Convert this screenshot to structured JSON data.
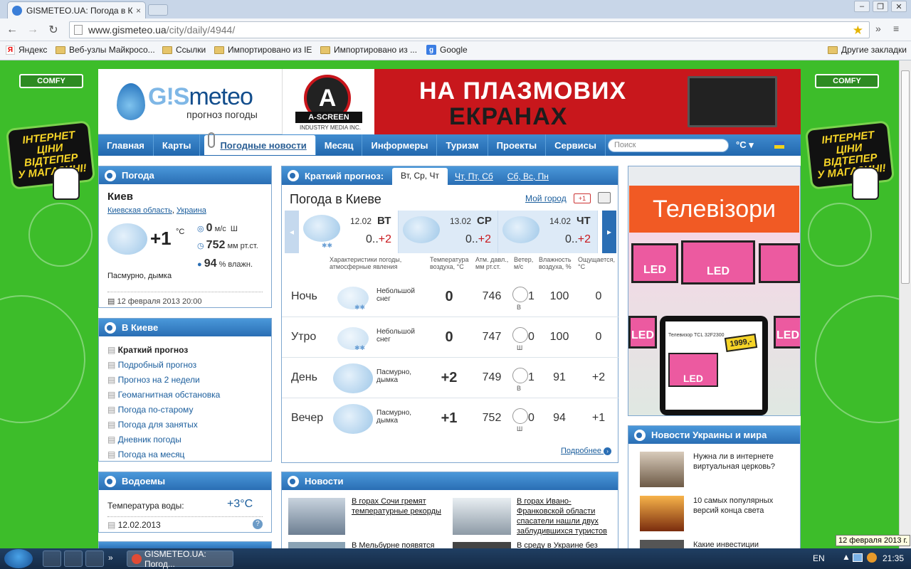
{
  "browser": {
    "tab_title": "GISMETEO.UA: Погода в Ки",
    "tab_close": "×",
    "url_host": "www.gismeteo.ua",
    "url_path": "/city/daily/4944/",
    "bookmarks": [
      {
        "label": "Яндекс",
        "icon": "yandex-icon"
      },
      {
        "label": "Веб-узлы Майкросо...",
        "icon": "folder-icon"
      },
      {
        "label": "Ссылки",
        "icon": "folder-icon"
      },
      {
        "label": "Импортировано из IE",
        "icon": "folder-icon"
      },
      {
        "label": "Импортировано из ...",
        "icon": "folder-icon"
      },
      {
        "label": "Google",
        "icon": "google-icon"
      }
    ],
    "other_bookmarks": "Другие закладки"
  },
  "side_ads": {
    "brand": "COMFY",
    "promo_lines": [
      "ІНТЕРНЕТ",
      "ЦІНИ",
      "ВІДТЕПЕР",
      "У МАГАЗИНІ!"
    ]
  },
  "header": {
    "logo_brand_a": "G!S",
    "logo_brand_b": "meteo",
    "logo_sub": "прогноз погоды",
    "ascreen_letter": "A",
    "ascreen_name": "A-SCREEN",
    "ascreen_tag": "INDUSTRY MEDIA INC.",
    "banner_line1": "НА ПЛАЗМОВИХ",
    "banner_line2": "ЕКРАНАХ"
  },
  "nav": {
    "items": [
      "Главная",
      "Карты",
      "Погодные новости",
      "Месяц",
      "Информеры",
      "Туризм",
      "Проекты",
      "Сервисы"
    ],
    "search_placeholder": "Поиск",
    "unit": "°C ▾"
  },
  "weather_box": {
    "title": "Погода",
    "city": "Киев",
    "region": "Киевская область",
    "country": "Украина",
    "temp": "+1",
    "temp_unit": "°C",
    "wind_val": "0",
    "wind_unit": "м/с",
    "wind_dir": "Ш",
    "pressure_val": "752",
    "pressure_unit": "мм рт.ст.",
    "humidity_val": "94",
    "humidity_unit": "% влажн.",
    "condition": "Пасмурно, дымка",
    "timestamp": "12 февраля 2013 20:00"
  },
  "kiev_box": {
    "title": "В Киеве",
    "links": [
      "Краткий прогноз",
      "Подробный прогноз",
      "Прогноз на 2 недели",
      "Геомагнитная обстановка",
      "Погода по-старому",
      "Погода для занятых",
      "Дневник погоды",
      "Погода на месяц"
    ]
  },
  "water_box": {
    "title": "Водоемы",
    "label": "Температура воды:",
    "value": "+3°C",
    "date": "12.02.2013",
    "help": "?"
  },
  "forecast": {
    "header": "Краткий прогноз:",
    "tab_selected": "Вт, Ср, Чт",
    "tab_2": "Чт, Пт, Сб",
    "tab_3": "Сб, Вс, Пн",
    "city_title": "Погода в Киеве",
    "my_city": "Мой город",
    "gplus": "+1",
    "days": [
      {
        "date": "12.02",
        "dow": "ВТ",
        "lo": "0..",
        "hi": "+2"
      },
      {
        "date": "13.02",
        "dow": "СР",
        "lo": "0..",
        "hi": "+2"
      },
      {
        "date": "14.02",
        "dow": "ЧТ",
        "lo": "0..",
        "hi": "+2"
      }
    ],
    "col_headers": [
      "Характеристики погоды, атмосферные явления",
      "Температура воздуха, °C",
      "Атм. давл., мм рт.ст.",
      "Ветер, м/с",
      "Влажность воздуха, %",
      "Ощущается, °C"
    ],
    "rows": [
      {
        "period": "Ночь",
        "desc": "Небольшой снег",
        "temp": "0",
        "press": "746",
        "wind_dir": "В",
        "wind": "1",
        "hum": "100",
        "feels": "0"
      },
      {
        "period": "Утро",
        "desc": "Небольшой снег",
        "temp": "0",
        "press": "747",
        "wind_dir": "Ш",
        "wind": "0",
        "hum": "100",
        "feels": "0"
      },
      {
        "period": "День",
        "desc": "Пасмурно, дымка",
        "temp": "+2",
        "press": "749",
        "wind_dir": "В",
        "wind": "1",
        "hum": "91",
        "feels": "+2"
      },
      {
        "period": "Вечер",
        "desc": "Пасмурно, дымка",
        "temp": "+1",
        "press": "752",
        "wind_dir": "Ш",
        "wind": "0",
        "hum": "94",
        "feels": "+1"
      }
    ],
    "more": "Подробнее"
  },
  "news": {
    "title": "Новости",
    "items": [
      "В горах Сочи гремят температурные рекорды",
      "В горах Ивано-Франковской области спасатели нашли двух заблудившихся туристов",
      "В Мельбурне появятся",
      "В среду в Украине без"
    ]
  },
  "ad_right": {
    "title": "Телевізори",
    "led": "LED",
    "tablet_text": "Телевизор TCL 32F2300",
    "price": "1999,-"
  },
  "world_news": {
    "title": "Новости Украины и мира",
    "items": [
      "Нужна ли в интернете виртуальная церковь?",
      "10 самых популярных версий конца света",
      "Какие инвестиции"
    ]
  },
  "taskbar": {
    "window_title": "GISMETEO.UA: Погод...",
    "lang": "EN",
    "clock": "21:35",
    "tooltip": "12 февраля 2013 г."
  }
}
